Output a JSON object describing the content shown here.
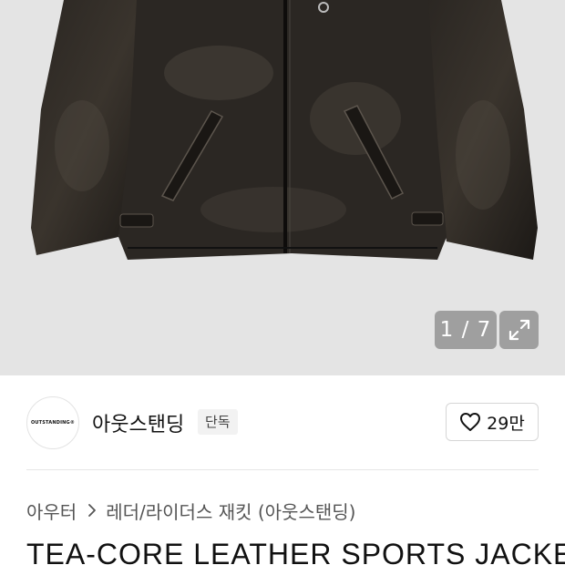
{
  "gallery": {
    "counter": "1 / 7",
    "expand_icon": "expand-icon",
    "image_alt": "black distressed leather sports jacket"
  },
  "brand": {
    "logo_text": "OUTSTANDING®",
    "name": "아웃스탠딩",
    "badge": "단독"
  },
  "like": {
    "icon": "heart-icon",
    "count": "29만"
  },
  "breadcrumb": {
    "category": "아우터",
    "subcategory": "레더/라이더스 재킷 (아웃스탠딩)"
  },
  "product": {
    "title": "TEA-CORE LEATHER SPORTS JACKE"
  },
  "colors": {
    "hero_bg": "#e4e4e4",
    "jacket": "#1f1c19",
    "overlay": "#8c8c8c"
  }
}
